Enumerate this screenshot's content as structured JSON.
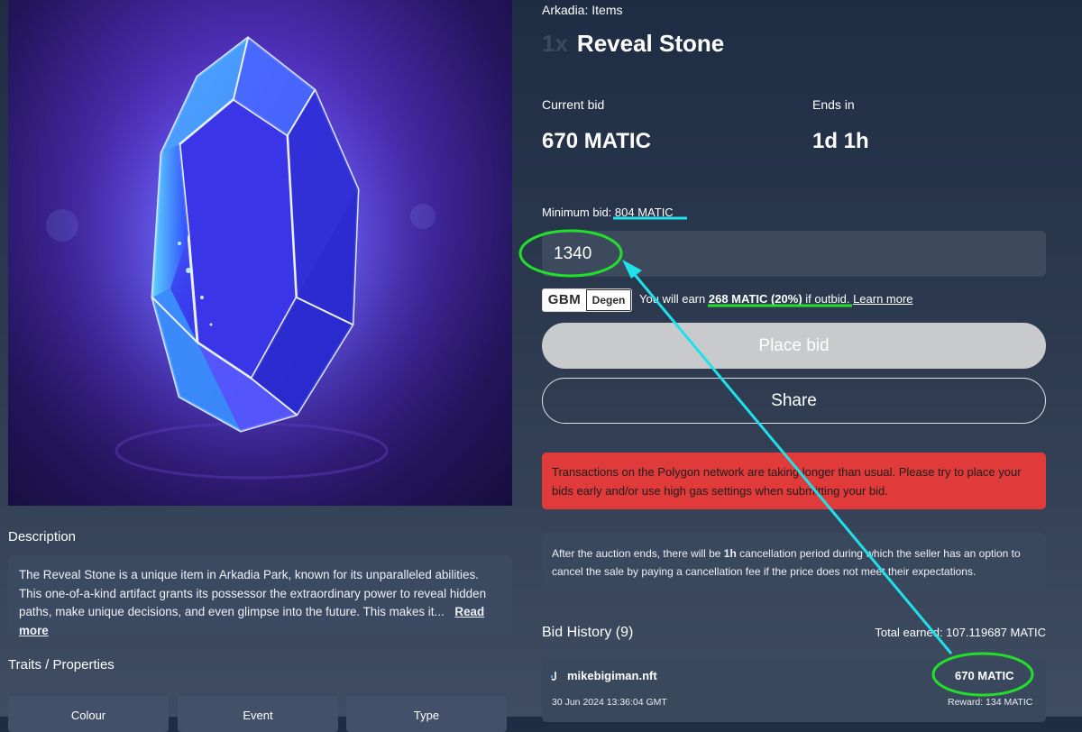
{
  "item": {
    "collection": "Arkadia: Items",
    "quantity": "1x",
    "name": "Reveal Stone"
  },
  "auction": {
    "current_bid_label": "Current bid",
    "current_bid": "670 MATIC",
    "ends_in_label": "Ends in",
    "ends_in": "1d 1h"
  },
  "bid_form": {
    "min_bid_label": "Minimum bid:",
    "min_bid_value": "804 MATIC",
    "input_value": "1340",
    "gbm_logo": "GBM",
    "gbm_badge": "Degen",
    "earn_prefix": "You will earn",
    "earn_amount": "268 MATIC (20%)",
    "earn_suffix": "if outbid.",
    "learn_more": "Learn more",
    "place_bid": "Place bid",
    "share": "Share"
  },
  "alerts": {
    "network_warning": "Transactions on the Polygon network are taking longer than usual. Please try to place your bids early and/or use high gas settings when submitting your bid.",
    "cancellation_pre": "After the auction ends, there will be",
    "cancellation_period": "1h",
    "cancellation_post": "cancellation period during which the seller has an option to cancel the sale by paying a cancellation fee if the price does not meet their expectations."
  },
  "description": {
    "title": "Description",
    "text": "The Reveal Stone is a unique item in Arkadia Park, known for its unparalleled abilities. This one-of-a-kind artifact grants its possessor the extraordinary power to reveal hidden paths, make unique decisions, and even glimpse into the future. This makes it...",
    "read_more": "Read more"
  },
  "traits": {
    "title": "Traits / Properties",
    "items": [
      "Colour",
      "Event",
      "Type"
    ]
  },
  "bid_history": {
    "title": "Bid History (9)",
    "total_earned": "Total earned: 107.119687 MATIC",
    "bids": [
      {
        "bidder": "mikebigiman.nft",
        "amount": "670 MATIC",
        "date": "30 Jun 2024 13:36:04 GMT",
        "reward": "Reward: 134 MATIC"
      }
    ]
  },
  "colors": {
    "annotation_green": "#22e02a",
    "annotation_cyan": "#20e0ea",
    "alert_red": "#e03a3a"
  }
}
